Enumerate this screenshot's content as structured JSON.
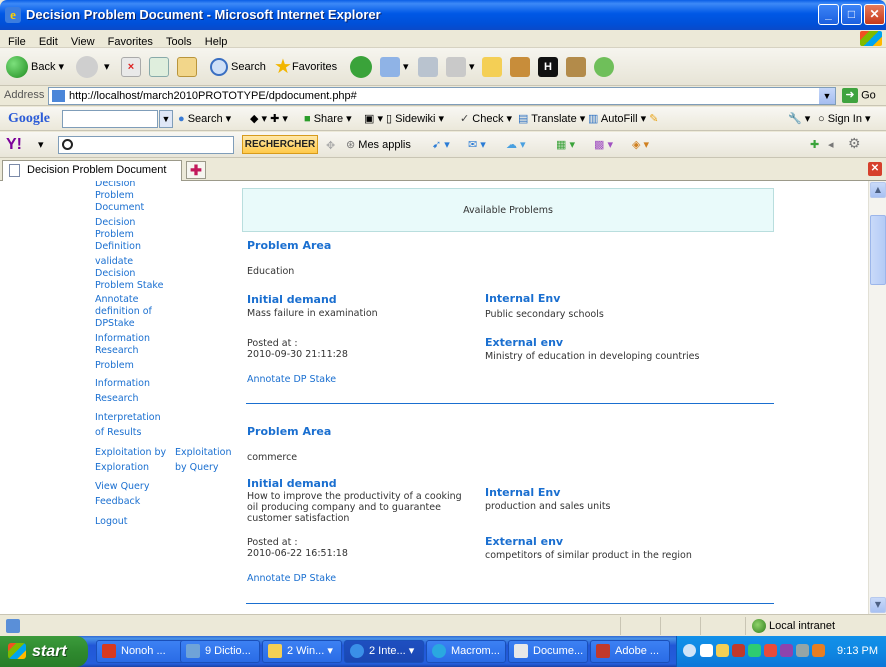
{
  "window": {
    "title": "Decision Problem Document - Microsoft Internet Explorer"
  },
  "menu": [
    "File",
    "Edit",
    "View",
    "Favorites",
    "Tools",
    "Help"
  ],
  "toolbar": {
    "back": "Back",
    "search": "Search",
    "favorites": "Favorites"
  },
  "address": {
    "label": "Address",
    "url": "http://localhost/march2010PROTOTYPE/dpdocument.php#",
    "go": "Go"
  },
  "google_bar": {
    "logo": "Google",
    "search": "Search",
    "share": "Share",
    "sidewiki": "Sidewiki",
    "check": "Check",
    "translate": "Translate",
    "autofill": "AutoFill",
    "sign_in": "Sign In"
  },
  "yahoo_bar": {
    "logo": "Y!",
    "rechercher": "RECHERCHER",
    "mes_applis": "Mes applis"
  },
  "tab": {
    "label": "Decision Problem Document"
  },
  "sidebar": {
    "items": [
      {
        "lines": [
          "Decision",
          "Problem",
          "Document"
        ]
      },
      {
        "lines": [
          "Decision",
          "Problem",
          "Definition"
        ]
      },
      {
        "lines": [
          "validate",
          "Decision",
          "Problem Stake"
        ]
      },
      {
        "lines": [
          "Annotate",
          "definition of",
          "DPStake"
        ]
      },
      {
        "lines": [
          "Information",
          "Research",
          "Problem"
        ]
      },
      {
        "lines": [
          "Information",
          "Research"
        ]
      },
      {
        "lines": [
          "Interpretation",
          "of Results"
        ]
      },
      {
        "lines": [
          "Exploitation by",
          "Exploration"
        ]
      },
      {
        "lines": [
          "Exploitation",
          "by Query"
        ]
      },
      {
        "lines": [
          "View Query",
          "Feedback"
        ]
      },
      {
        "lines": [
          "Logout"
        ]
      }
    ]
  },
  "main": {
    "banner": "Available Problems",
    "problems": [
      {
        "area_title": "Problem Area",
        "area": "Education",
        "initial_title": "Initial demand",
        "initial": "Mass failure in examination",
        "posted_label": "Posted at :",
        "posted": "2010-09-30 21:11:28",
        "internal_title": "Internal Env",
        "internal": "Public secondary schools",
        "external_title": "External env",
        "external": "Ministry of education in developing countries",
        "annotate": "Annotate DP Stake"
      },
      {
        "area_title": "Problem Area",
        "area": "commerce",
        "initial_title": "Initial demand",
        "initial_lines": [
          "How to improve the productivity of a cooking",
          "oil producing company and to guarantee",
          "customer satisfaction"
        ],
        "posted_label": "Posted at :",
        "posted": "2010-06-22 16:51:18",
        "internal_title": "Internal Env",
        "internal": "production and sales units",
        "external_title": "External env",
        "external": "competitors of similar product in the region",
        "annotate": "Annotate DP Stake"
      }
    ]
  },
  "status": {
    "zone": "Local intranet"
  },
  "taskbar": {
    "start": "start",
    "tasks": [
      "Nonoh ...",
      "9 Dictio...",
      "2 Win...",
      "2 Inte...",
      "Macrom...",
      "Docume...",
      "Adobe ..."
    ],
    "clock": "9:13 PM"
  }
}
